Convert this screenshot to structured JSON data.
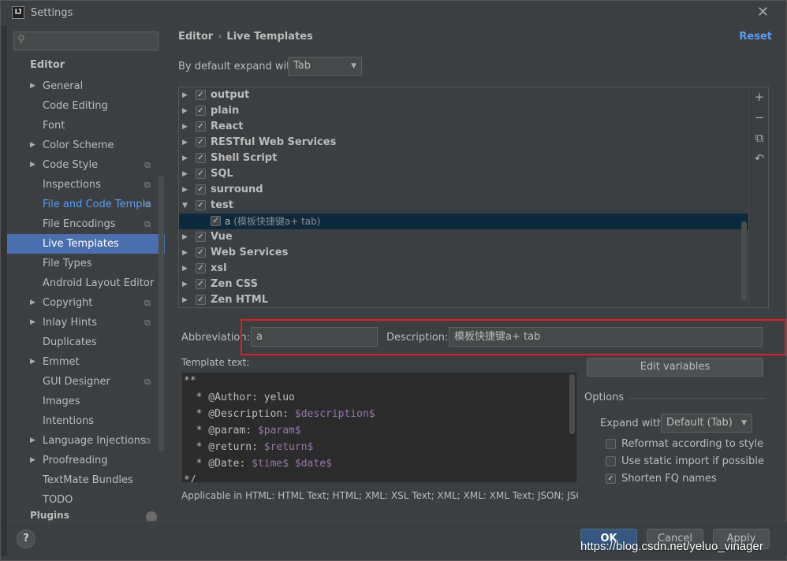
{
  "window": {
    "title": "Settings",
    "app_icon": "IJ"
  },
  "search": {
    "placeholder": ""
  },
  "sidebar": {
    "section": "Editor",
    "items": [
      {
        "label": "General",
        "arrow": true,
        "proj": false
      },
      {
        "label": "Code Editing",
        "arrow": false,
        "proj": false
      },
      {
        "label": "Font",
        "arrow": false,
        "proj": false
      },
      {
        "label": "Color Scheme",
        "arrow": true,
        "proj": false
      },
      {
        "label": "Code Style",
        "arrow": true,
        "proj": true
      },
      {
        "label": "Inspections",
        "arrow": false,
        "proj": true
      },
      {
        "label": "File and Code Templa",
        "arrow": false,
        "proj": true
      },
      {
        "label": "File Encodings",
        "arrow": false,
        "proj": true
      },
      {
        "label": "Live Templates",
        "arrow": false,
        "proj": false
      },
      {
        "label": "File Types",
        "arrow": false,
        "proj": false
      },
      {
        "label": "Android Layout Editor",
        "arrow": false,
        "proj": false
      },
      {
        "label": "Copyright",
        "arrow": true,
        "proj": true
      },
      {
        "label": "Inlay Hints",
        "arrow": true,
        "proj": true
      },
      {
        "label": "Duplicates",
        "arrow": false,
        "proj": false
      },
      {
        "label": "Emmet",
        "arrow": true,
        "proj": false
      },
      {
        "label": "GUI Designer",
        "arrow": false,
        "proj": true
      },
      {
        "label": "Images",
        "arrow": false,
        "proj": false
      },
      {
        "label": "Intentions",
        "arrow": false,
        "proj": false
      },
      {
        "label": "Language Injections",
        "arrow": true,
        "proj": true
      },
      {
        "label": "Proofreading",
        "arrow": true,
        "proj": false
      },
      {
        "label": "TextMate Bundles",
        "arrow": false,
        "proj": false
      },
      {
        "label": "TODO",
        "arrow": false,
        "proj": false
      }
    ],
    "cutoff_label": "Plugins"
  },
  "header": {
    "breadcrumb_parent": "Editor",
    "breadcrumb_sep": "›",
    "breadcrumb_current": "Live Templates",
    "reset_label": "Reset"
  },
  "expand_default": {
    "label": "By default expand with",
    "value": "Tab"
  },
  "templates": [
    {
      "label": "output",
      "expanded": false,
      "checked": true
    },
    {
      "label": "plain",
      "expanded": false,
      "checked": true
    },
    {
      "label": "React",
      "expanded": false,
      "checked": true
    },
    {
      "label": "RESTful Web Services",
      "expanded": false,
      "checked": true
    },
    {
      "label": "Shell Script",
      "expanded": false,
      "checked": true
    },
    {
      "label": "SQL",
      "expanded": false,
      "checked": true
    },
    {
      "label": "surround",
      "expanded": false,
      "checked": true
    },
    {
      "label": "test",
      "expanded": true,
      "checked": true,
      "children": [
        {
          "abbr": "a",
          "desc": "(模板快捷键a+ tab)"
        }
      ]
    },
    {
      "label": "Vue",
      "expanded": false,
      "checked": true
    },
    {
      "label": "Web Services",
      "expanded": false,
      "checked": true
    },
    {
      "label": "xsl",
      "expanded": false,
      "checked": true
    },
    {
      "label": "Zen CSS",
      "expanded": false,
      "checked": true
    },
    {
      "label": "Zen HTML",
      "expanded": false,
      "checked": true
    }
  ],
  "tools": {
    "add": "+",
    "remove": "−",
    "copy": "⧉",
    "restore": "↶"
  },
  "form": {
    "abbreviation_label": "Abbreviation:",
    "abbreviation_value": "a",
    "description_label": "Description:",
    "description_value": "模板快捷键a+ tab",
    "template_text_label": "Template text:"
  },
  "code": [
    [
      {
        "t": "**"
      }
    ],
    [
      {
        "t": "  * @Author: yeluo"
      }
    ],
    [
      {
        "t": "  * @Description: "
      },
      {
        "t": "$description$",
        "v": true
      }
    ],
    [
      {
        "t": "  * @param: "
      },
      {
        "t": "$param$",
        "v": true
      }
    ],
    [
      {
        "t": "  * @return: "
      },
      {
        "t": "$return$",
        "v": true
      }
    ],
    [
      {
        "t": "  * @Date: "
      },
      {
        "t": "$time$",
        "v": true
      },
      {
        "t": " "
      },
      {
        "t": "$date$",
        "v": true
      }
    ],
    [
      {
        "t": "*/"
      }
    ]
  ],
  "applicable": "Applicable in HTML: HTML Text; HTML; XML: XSL Text; XML; XML: XML Text; JSON; JSC",
  "options": {
    "edit_variables_label": "Edit variables",
    "title": "Options",
    "expand_with_label": "Expand with",
    "expand_with_value": "Default (Tab)",
    "reformat_label": "Reformat according to style",
    "reformat_checked": false,
    "static_import_label": "Use static import if possible",
    "static_import_checked": false,
    "shorten_fq_label": "Shorten FQ names",
    "shorten_fq_checked": true
  },
  "buttons": {
    "help": "?",
    "ok": "OK",
    "cancel": "Cancel",
    "apply": "Apply"
  },
  "watermark": "https://blog.csdn.net/yeluo_vinager"
}
